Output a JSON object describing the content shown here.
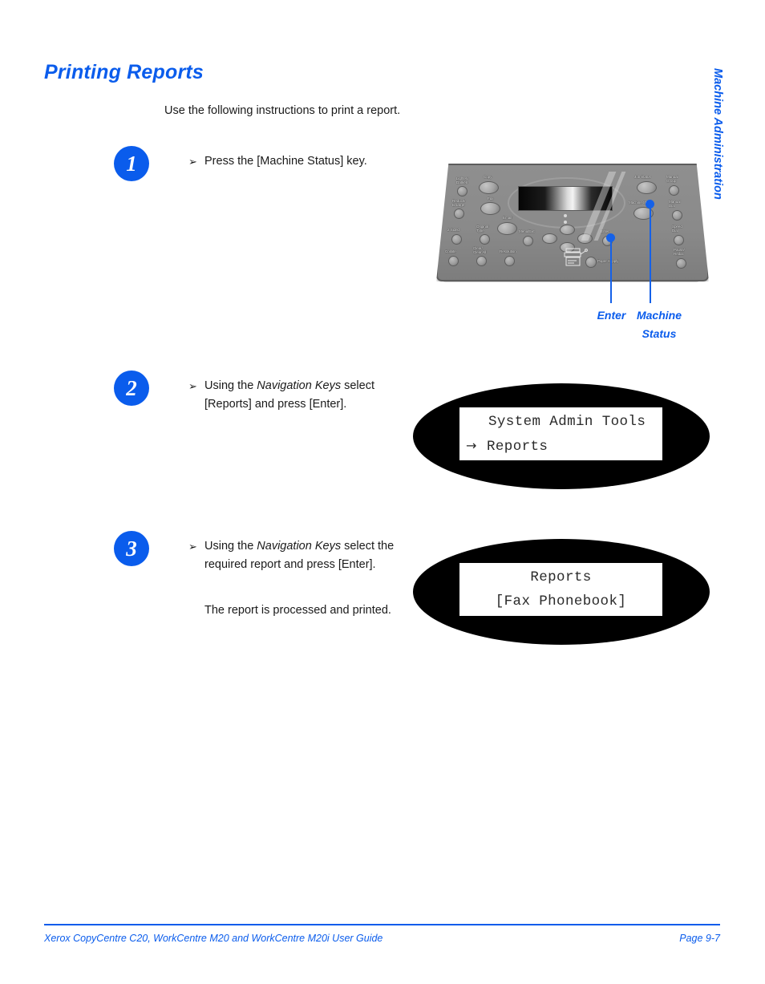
{
  "page": {
    "heading": "Printing Reports",
    "intro": "Use the following instructions to print a report.",
    "side_tab": "Machine Administration",
    "accent_color": "#0a5cec"
  },
  "steps": [
    {
      "number": "1",
      "bullet": "➢",
      "text": "Press the [Machine Status] key."
    },
    {
      "number": "2",
      "bullet": "➢",
      "text_before": "Using the ",
      "text_italic": "Navigation Keys",
      "text_after": " select [Reports] and press [Enter]."
    },
    {
      "number": "3",
      "bullet": "➢",
      "text_before": "Using the ",
      "text_italic": "Navigation Keys",
      "text_after": " select the required report and press [Enter].",
      "note": "The report is processed and printed."
    }
  ],
  "control_panel": {
    "callouts": [
      {
        "label": "Enter"
      },
      {
        "label": "Machine",
        "label2": "Status"
      }
    ],
    "buttons": [
      {
        "label": "Lighten/\nDarken"
      },
      {
        "label": "Reduce/\nEnlarge"
      },
      {
        "label": "2 Sided"
      },
      {
        "label": "Original\nType"
      },
      {
        "label": "Collate"
      },
      {
        "label": "Clear All"
      },
      {
        "label": "Resolution"
      },
      {
        "label": "Copy"
      },
      {
        "label": "Fax"
      },
      {
        "label": "Email"
      },
      {
        "label": "Menu/Exit"
      },
      {
        "label": "Enter"
      },
      {
        "label": "Paper Supply"
      },
      {
        "label": "Job Status"
      },
      {
        "label": "Machine Status"
      },
      {
        "label": "Manual\nGroup"
      },
      {
        "label": "Manual\nDial"
      },
      {
        "label": "Speed\nDial"
      },
      {
        "label": "Pause/\nRedial"
      }
    ]
  },
  "displays": [
    {
      "line1": "System Admin Tools",
      "arrow": "→",
      "line2": "Reports"
    },
    {
      "line1": "Reports",
      "line2": "[Fax Phonebook]"
    }
  ],
  "footer": {
    "left": "Xerox CopyCentre C20, WorkCentre M20 and WorkCentre M20i User Guide",
    "right": "Page 9-7"
  }
}
